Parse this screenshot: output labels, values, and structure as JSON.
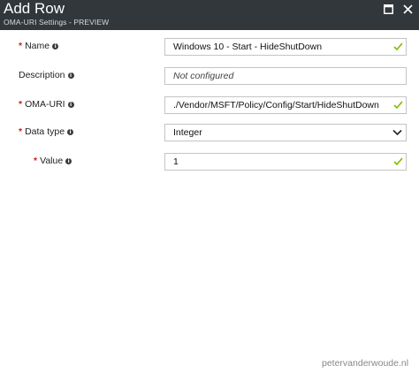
{
  "header": {
    "title": "Add Row",
    "subtitle": "OMA-URI Settings - PREVIEW"
  },
  "form": {
    "name": {
      "label": "Name",
      "required": "*",
      "value": "Windows 10 - Start - HideShutDown"
    },
    "description": {
      "label": "Description",
      "placeholder": "Not configured"
    },
    "oma_uri": {
      "label": "OMA-URI",
      "required": "*",
      "value": "./Vendor/MSFT/Policy/Config/Start/HideShutDown"
    },
    "data_type": {
      "label": "Data type",
      "required": "*",
      "value": "Integer"
    },
    "value": {
      "label": "Value",
      "required": "*",
      "value": "1"
    }
  },
  "footer": {
    "credit": "petervanderwoude.nl"
  },
  "colors": {
    "header_bg": "#32373b",
    "required": "#c4231d",
    "valid_check": "#7fba00",
    "field_border": "#c4c4c4"
  },
  "icons": {
    "info": "info-icon",
    "valid": "check-icon",
    "dropdown": "chevron-down-icon",
    "maximize": "maximize-icon",
    "close": "close-icon"
  }
}
